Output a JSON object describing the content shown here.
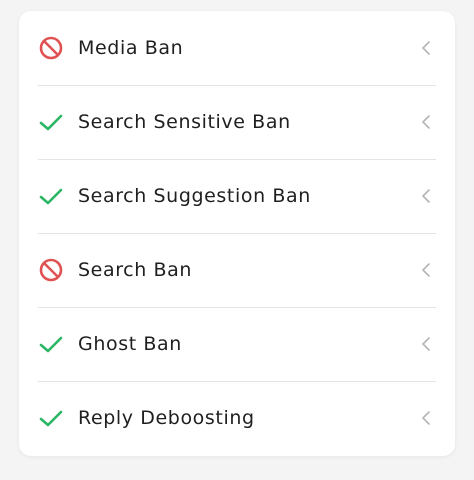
{
  "colors": {
    "ban": "#e05252",
    "ok": "#2bb664",
    "chevron": "#b5b5b5",
    "text": "#1f1f1f"
  },
  "items": [
    {
      "label": "Media Ban",
      "status": "banned",
      "icon": "no-entry-icon"
    },
    {
      "label": "Search Sensitive Ban",
      "status": "ok",
      "icon": "checkmark-icon"
    },
    {
      "label": "Search Suggestion Ban",
      "status": "ok",
      "icon": "checkmark-icon"
    },
    {
      "label": "Search Ban",
      "status": "banned",
      "icon": "no-entry-icon"
    },
    {
      "label": "Ghost Ban",
      "status": "ok",
      "icon": "checkmark-icon"
    },
    {
      "label": "Reply Deboosting",
      "status": "ok",
      "icon": "checkmark-icon"
    }
  ]
}
